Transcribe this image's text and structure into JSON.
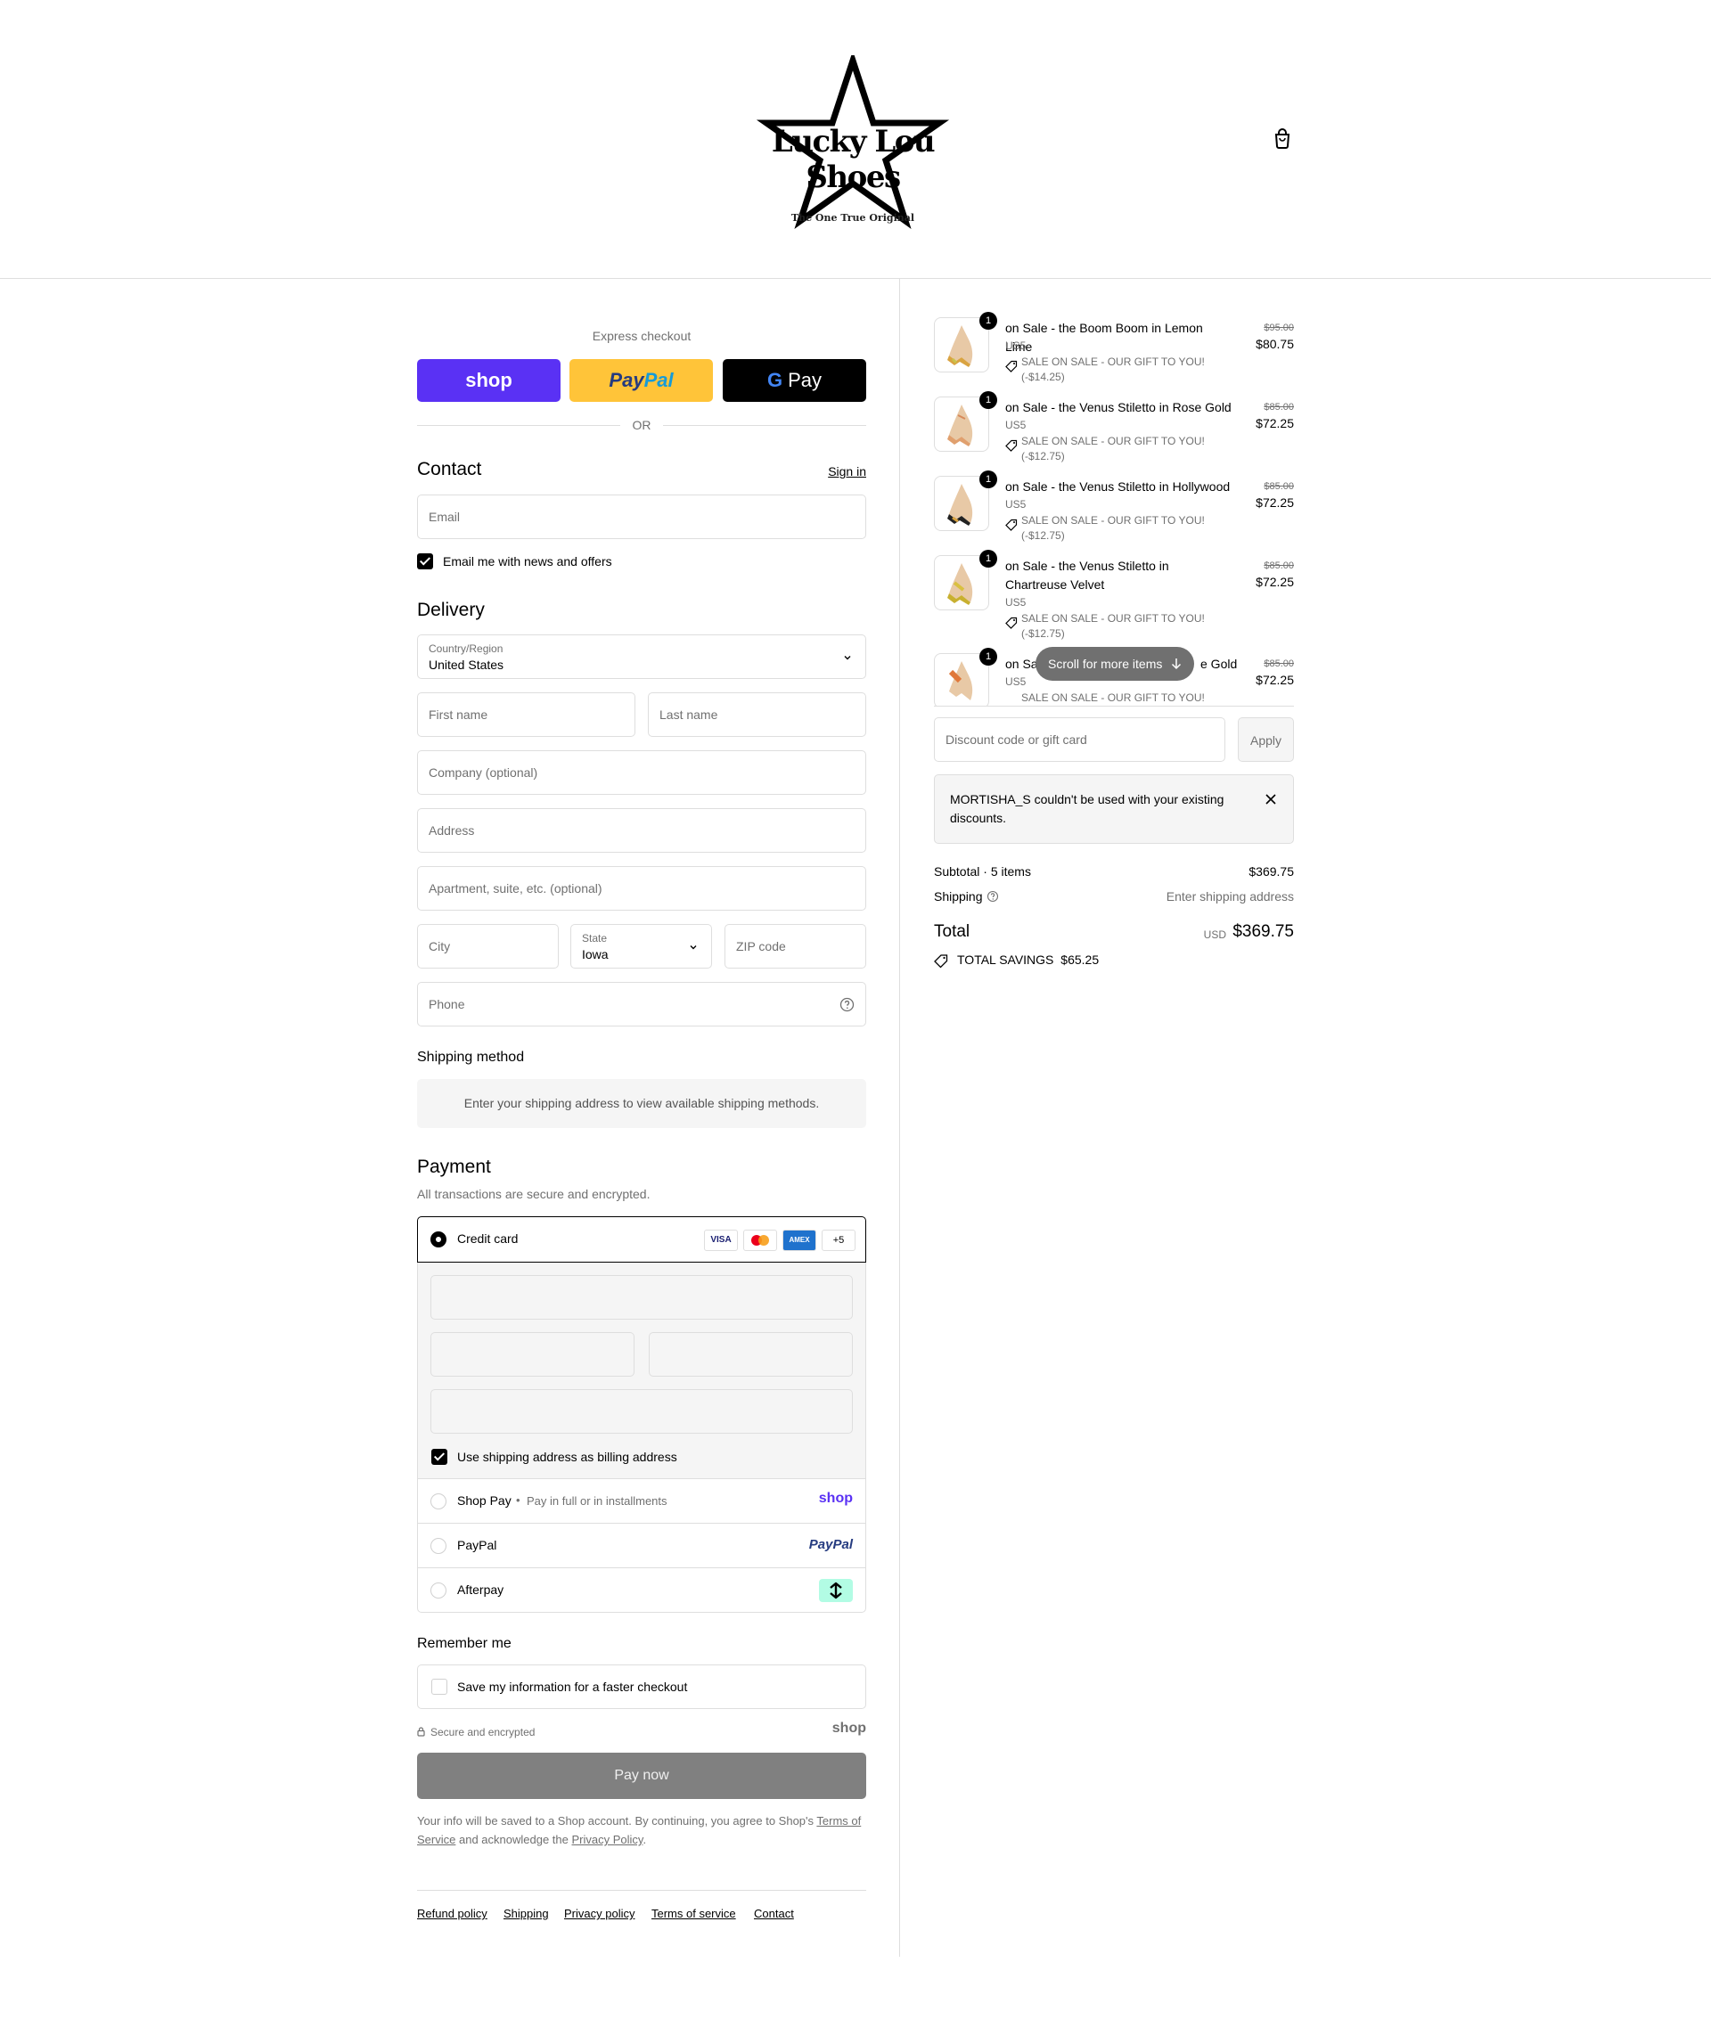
{
  "brand": {
    "name": "Lucky Lou Shoes",
    "tagline": "The One True Original",
    "cart_icon": "shopping-bag-icon"
  },
  "express": {
    "title": "Express checkout",
    "shop_label": "shop",
    "paypal_label_1": "Pay",
    "paypal_label_2": "Pal",
    "gpay_g": "G",
    "gpay_label": "Pay",
    "or_label": "OR"
  },
  "contact": {
    "title": "Contact",
    "sign_in": "Sign in",
    "email_placeholder": "Email",
    "news_label": "Email me with news and offers",
    "news_checked": true
  },
  "delivery": {
    "title": "Delivery",
    "country_label": "Country/Region",
    "country_value": "United States",
    "first_name": "First name",
    "last_name": "Last name",
    "company": "Company (optional)",
    "address": "Address",
    "apartment": "Apartment, suite, etc. (optional)",
    "city": "City",
    "state_label": "State",
    "state_value": "Iowa",
    "zip": "ZIP code",
    "phone": "Phone"
  },
  "shipping_method": {
    "title": "Shipping method",
    "message": "Enter your shipping address to view available shipping methods."
  },
  "payment": {
    "title": "Payment",
    "subtitle": "All transactions are secure and encrypted.",
    "credit_card_label": "Credit card",
    "card_brands": [
      "VISA",
      "mastercard",
      "AMEX"
    ],
    "more_cards": "+5",
    "billing_label": "Use shipping address as billing address",
    "shop_pay_label": "Shop Pay",
    "shop_pay_sub": "Pay in full or in installments",
    "shop_pay_logo": "shop",
    "paypal_label": "PayPal",
    "paypal_logo": "PayPal",
    "afterpay_label": "Afterpay"
  },
  "remember": {
    "title": "Remember me",
    "save_label": "Save my information for a faster checkout",
    "secure_label": "Secure and encrypted",
    "shop_logo": "shop"
  },
  "pay_now": "Pay now",
  "legal": {
    "text_1": "Your info will be saved to a Shop account. By continuing, you agree to Shop's",
    "terms": "Terms of Service",
    "text_2": "and acknowledge the",
    "privacy": "Privacy Policy",
    "text_3": "."
  },
  "footer_links": [
    "Refund policy",
    "Shipping",
    "Privacy policy",
    "Terms of service",
    "Contact"
  ],
  "cart": {
    "items": [
      {
        "qty": "1",
        "name": "on Sale - the Boom Boom in Lemon Lime",
        "variant": "US5",
        "discount": "SALE ON SALE - OUR GIFT TO YOU!",
        "discount_amount": "(-$14.25)",
        "old_price": "$95.00",
        "price": "$80.75"
      },
      {
        "qty": "1",
        "name": "on Sale - the Venus Stiletto in Rose Gold",
        "variant": "US5",
        "discount": "SALE ON SALE - OUR GIFT TO YOU!",
        "discount_amount": "(-$12.75)",
        "old_price": "$85.00",
        "price": "$72.25"
      },
      {
        "qty": "1",
        "name": "on Sale - the Venus Stiletto in Hollywood",
        "variant": "US5",
        "discount": "SALE ON SALE - OUR GIFT TO YOU!",
        "discount_amount": "(-$12.75)",
        "old_price": "$85.00",
        "price": "$72.25"
      },
      {
        "qty": "1",
        "name": "on Sale - the Venus Stiletto in Chartreuse Velvet",
        "variant": "US5",
        "discount": "SALE ON SALE - OUR GIFT TO YOU!",
        "discount_amount": "(-$12.75)",
        "old_price": "$85.00",
        "price": "$72.25"
      },
      {
        "qty": "1",
        "name_left": "on Sa",
        "name_right": "e Gold",
        "variant": "US5",
        "discount": "SALE ON SALE - OUR GIFT TO YOU!",
        "old_price": "$85.00",
        "price": "$72.25"
      }
    ],
    "scroll_hint": "Scroll for more items",
    "discount_placeholder": "Discount code or gift card",
    "apply_label": "Apply",
    "error_message": "MORTISHA_S couldn't be used with your existing discounts.",
    "subtotal_label": "Subtotal · 5 items",
    "subtotal_value": "$369.75",
    "shipping_label": "Shipping",
    "shipping_value": "Enter shipping address",
    "total_label": "Total",
    "total_currency": "USD",
    "total_value": "$369.75",
    "savings_label": "TOTAL SAVINGS",
    "savings_value": "$65.25"
  }
}
